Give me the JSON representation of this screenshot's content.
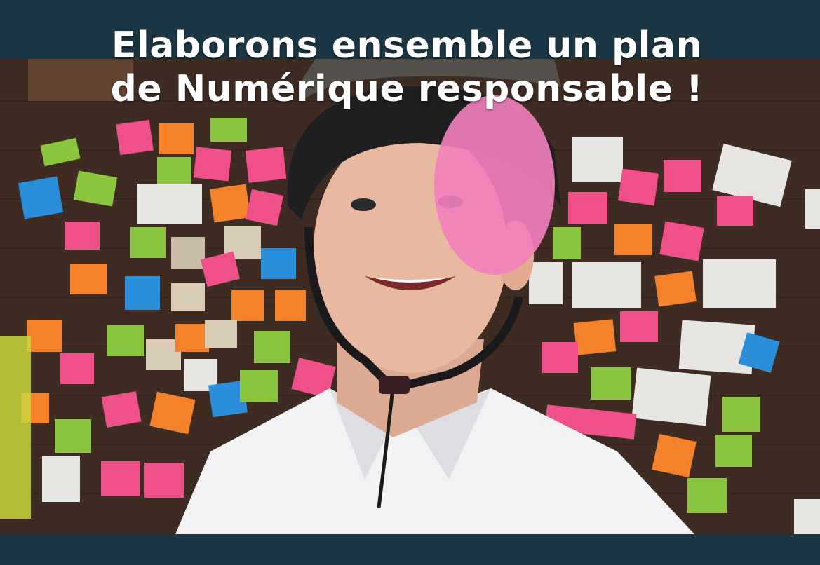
{
  "headline": {
    "line1": "Elaborons ensemble un plan",
    "line2": "de Numérique responsable !"
  },
  "colors": {
    "band": "#1b3644",
    "headline_text": "#ffffff",
    "wall": "#3e2c23",
    "note_pink": "#f0508a",
    "note_orange": "#f5822a",
    "note_green": "#8cc63e",
    "note_blue": "#2a8fd8",
    "note_white": "#e8e6e2",
    "shirt": "#f2f2f4",
    "skin": "#e9b8a0",
    "helmet": "#1f1f22"
  },
  "photo_subject": "smiling-man-in-bike-helmet-in-front-of-sticky-note-wall"
}
